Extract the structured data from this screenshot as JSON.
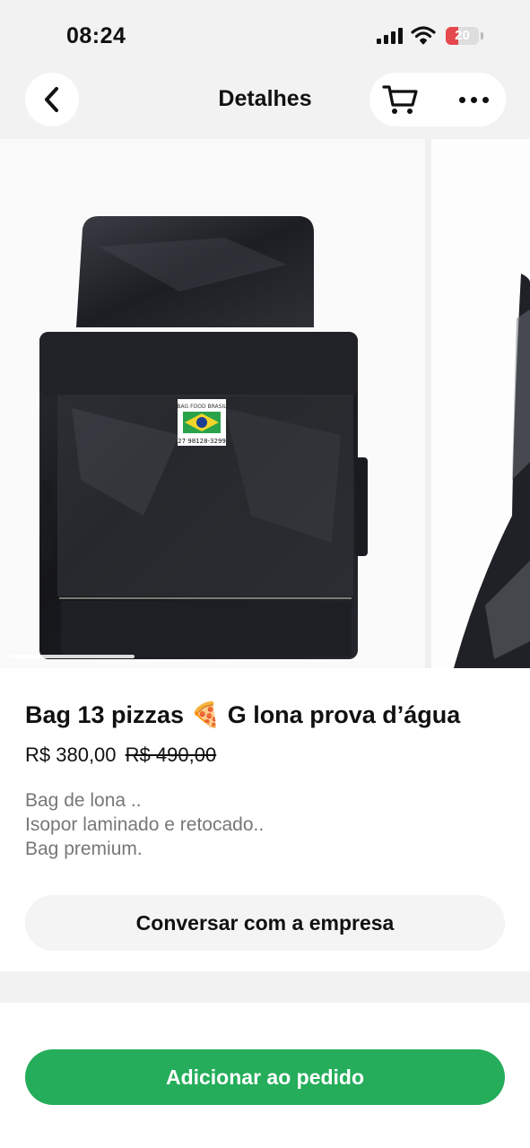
{
  "status_bar": {
    "time": "08:24",
    "battery_level": "20",
    "icons": [
      "signal-icon",
      "wifi-icon",
      "battery-icon"
    ],
    "battery_color": "#e5484d"
  },
  "nav": {
    "title": "Detalhes",
    "back_icon": "chevron-left-icon",
    "cart_icon": "cart-icon",
    "more_icon": "more-dots-icon"
  },
  "gallery": {
    "images": [
      {
        "label": "BAG FOOD BRASIL",
        "phone": "27 98128-3299"
      },
      {}
    ]
  },
  "product": {
    "title": "Bag 13 pizzas 🍕 G lona prova d’água",
    "price": "R$ 380,00",
    "old_price": "R$ 490,00",
    "description": [
      "Bag de lona ..",
      "Isopor laminado e retocado..",
      "Bag premium."
    ]
  },
  "actions": {
    "chat_label": "Conversar com a empresa",
    "add_label": "Adicionar ao pedido"
  },
  "colors": {
    "accent": "#25ad5b",
    "background": "#f2f2f2"
  }
}
